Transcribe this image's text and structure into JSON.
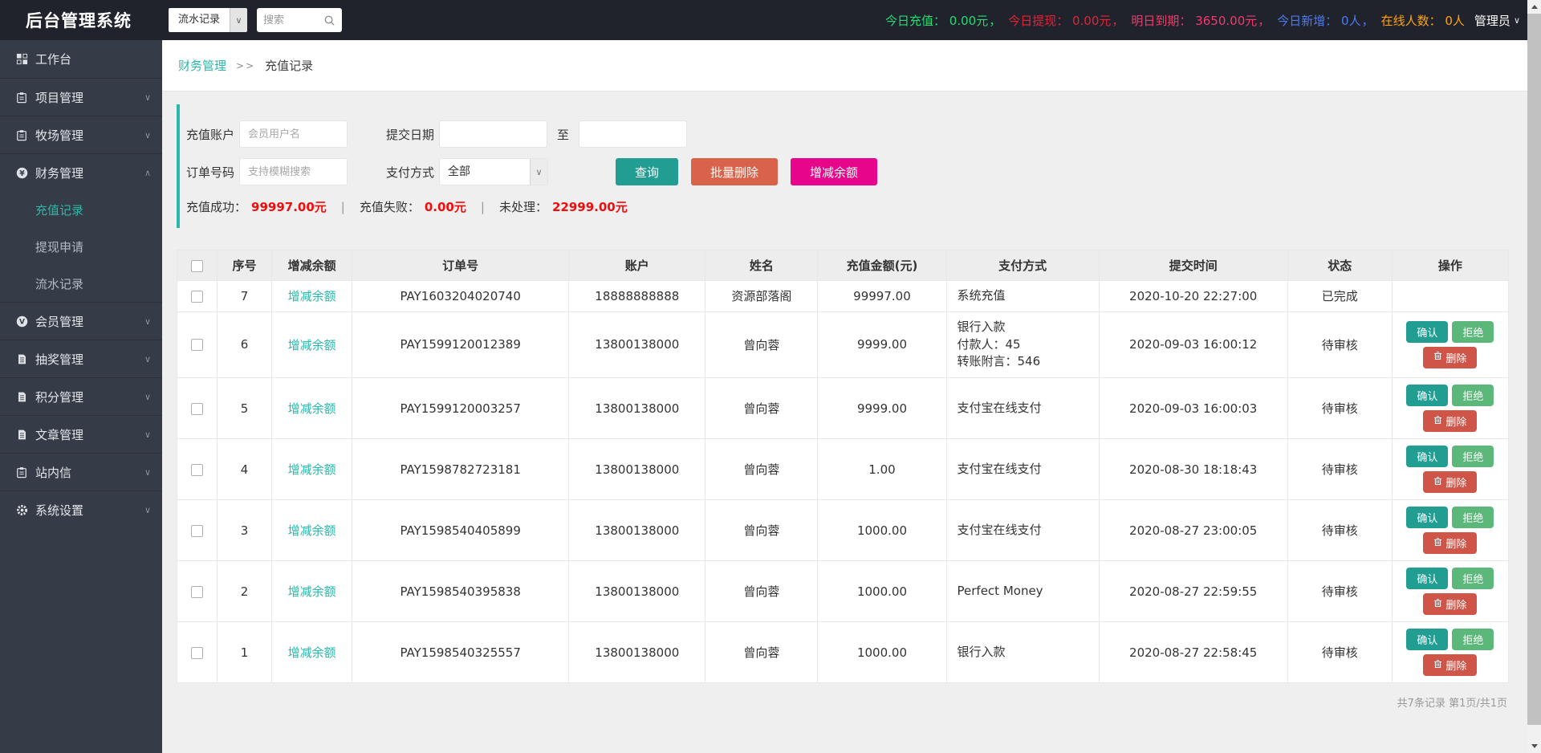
{
  "topbar": {
    "title": "后台管理系统",
    "module_select": "流水记录",
    "search_placeholder": "搜索",
    "stats": [
      {
        "label": "今日充值：",
        "value": "0.00元",
        "sep": "，",
        "color": "#1fdd72"
      },
      {
        "label": "今日提现：",
        "value": "0.00元",
        "sep": "，",
        "color": "#e02438"
      },
      {
        "label": "明日到期：",
        "value": "3650.00元",
        "sep": "，",
        "color": "#f23a6b"
      },
      {
        "label": "今日新增：",
        "value": "0人",
        "sep": "，",
        "color": "#4d7bf3"
      },
      {
        "label": "在线人数：",
        "value": "0人",
        "sep": "",
        "color": "#ffa408"
      }
    ],
    "admin_label": "管理员"
  },
  "sidebar": {
    "items": [
      {
        "label": "工作台",
        "icon": "dashboard-icon",
        "chevron": null
      },
      {
        "label": "项目管理",
        "icon": "clipboard-icon",
        "chevron": "down"
      },
      {
        "label": "牧场管理",
        "icon": "clipboard-icon",
        "chevron": "down"
      },
      {
        "label": "财务管理",
        "icon": "finance-coin-icon",
        "chevron": "up",
        "expanded": true,
        "children": [
          {
            "label": "充值记录",
            "active": true
          },
          {
            "label": "提现申请",
            "active": false
          },
          {
            "label": "流水记录",
            "active": false
          }
        ]
      },
      {
        "label": "会员管理",
        "icon": "member-coin-icon",
        "chevron": "down"
      },
      {
        "label": "抽奖管理",
        "icon": "document-icon",
        "chevron": "down"
      },
      {
        "label": "积分管理",
        "icon": "document-icon",
        "chevron": "down"
      },
      {
        "label": "文章管理",
        "icon": "document-icon",
        "chevron": "down"
      },
      {
        "label": "站内信",
        "icon": "clipboard-icon",
        "chevron": "down"
      },
      {
        "label": "系统设置",
        "icon": "gear-icon",
        "chevron": "down"
      }
    ]
  },
  "breadcrumb": {
    "parent": "财务管理",
    "separator": ">>",
    "current": "充值记录"
  },
  "filter": {
    "account_label": "充值账户",
    "account_placeholder": "会员用户名",
    "date_label": "提交日期",
    "date_to": "至",
    "order_label": "订单号码",
    "order_placeholder": "支持模糊搜索",
    "pay_label": "支付方式",
    "pay_value": "全部",
    "buttons": {
      "query": "查询",
      "batch_delete": "批量删除",
      "adjust_balance": "增减余额"
    },
    "summary": [
      {
        "label": "充值成功：",
        "value": "99997.00元"
      },
      {
        "label": "充值失败：",
        "value": "0.00元"
      },
      {
        "label": "未处理：",
        "value": "22999.00元"
      }
    ],
    "summary_divider": "|"
  },
  "table": {
    "headers": [
      "序号",
      "增减余额",
      "订单号",
      "账户",
      "姓名",
      "充值金额(元)",
      "支付方式",
      "提交时间",
      "状态",
      "操作"
    ],
    "adjust_link": "增减余额",
    "action_labels": {
      "confirm": "确认",
      "reject": "拒绝",
      "delete": "删除"
    },
    "rows": [
      {
        "seq": "7",
        "order": "PAY1603204020740",
        "account": "18888888888",
        "name": "资源部落阁",
        "amount": "99997.00",
        "payment": [
          "系统充值"
        ],
        "time": "2020-10-20 22:27:00",
        "status": "已完成",
        "actions": false
      },
      {
        "seq": "6",
        "order": "PAY1599120012389",
        "account": "13800138000",
        "name": "曾向蓉",
        "amount": "9999.00",
        "payment": [
          "银行入款",
          "付款人：45",
          "转账附言：546"
        ],
        "time": "2020-09-03 16:00:12",
        "status": "待审核",
        "actions": true
      },
      {
        "seq": "5",
        "order": "PAY1599120003257",
        "account": "13800138000",
        "name": "曾向蓉",
        "amount": "9999.00",
        "payment": [
          "支付宝在线支付"
        ],
        "time": "2020-09-03 16:00:03",
        "status": "待审核",
        "actions": true
      },
      {
        "seq": "4",
        "order": "PAY1598782723181",
        "account": "13800138000",
        "name": "曾向蓉",
        "amount": "1.00",
        "payment": [
          "支付宝在线支付"
        ],
        "time": "2020-08-30 18:18:43",
        "status": "待审核",
        "actions": true
      },
      {
        "seq": "3",
        "order": "PAY1598540405899",
        "account": "13800138000",
        "name": "曾向蓉",
        "amount": "1000.00",
        "payment": [
          "支付宝在线支付"
        ],
        "time": "2020-08-27 23:00:05",
        "status": "待审核",
        "actions": true
      },
      {
        "seq": "2",
        "order": "PAY1598540395838",
        "account": "13800138000",
        "name": "曾向蓉",
        "amount": "1000.00",
        "payment": [
          "Perfect Money"
        ],
        "time": "2020-08-27 22:59:55",
        "status": "待审核",
        "actions": true
      },
      {
        "seq": "1",
        "order": "PAY1598540325557",
        "account": "13800138000",
        "name": "曾向蓉",
        "amount": "1000.00",
        "payment": [
          "银行入款"
        ],
        "time": "2020-08-27 22:58:45",
        "status": "待审核",
        "actions": true
      }
    ]
  },
  "pagination": {
    "text": "共7条记录 第1页/共1页"
  },
  "colors": {
    "accent_teal": "#2bb8aa",
    "danger_red": "#f20d0d",
    "button_teal": "#229d92",
    "button_salmon": "#d9634a",
    "button_magenta": "#e7058b",
    "button_green": "#5cb87a",
    "button_delete_red": "#cf5549",
    "topbar_bg": "#20222c",
    "sidebar_bg": "#353b47"
  }
}
